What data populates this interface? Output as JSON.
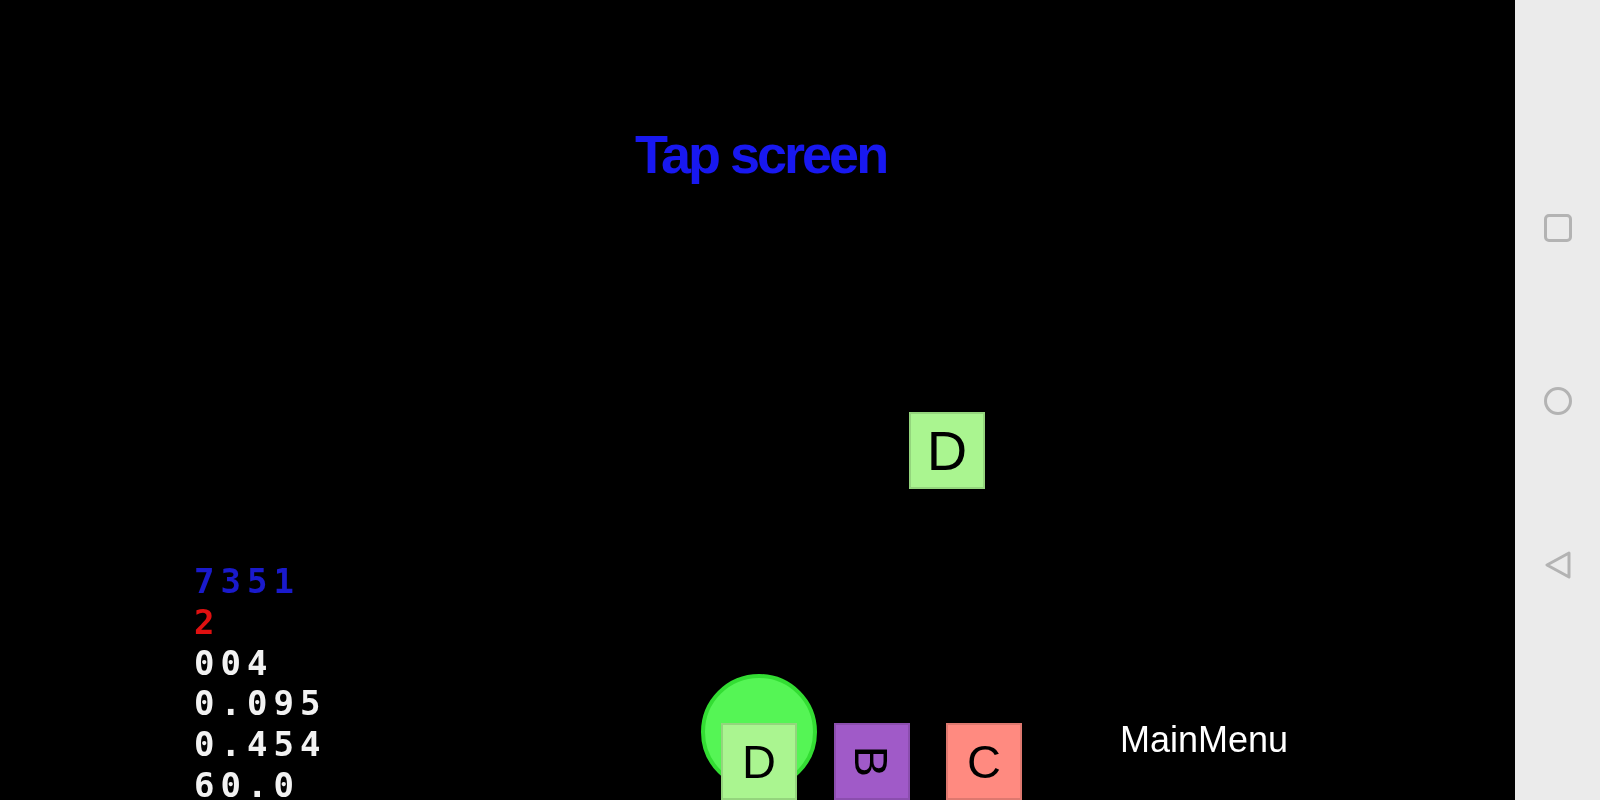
{
  "title": "Tap screen",
  "stats": [
    {
      "text": "7351",
      "color": "#1a1acc"
    },
    {
      "text": "2",
      "color": "#e01010"
    },
    {
      "text": "004",
      "color": "#f2f2f2"
    },
    {
      "text": "0.095",
      "color": "#f2f2f2"
    },
    {
      "text": "0.454",
      "color": "#f2f2f2"
    },
    {
      "text": "60.0",
      "color": "#f2f2f2"
    }
  ],
  "falling_tiles": [
    {
      "letter": "D",
      "color": "#aaf590"
    }
  ],
  "tray_tiles": [
    {
      "letter": "D",
      "color": "#aaf590",
      "selected": true,
      "rotated": false
    },
    {
      "letter": "B",
      "color": "#a05ac8",
      "selected": false,
      "rotated": true
    },
    {
      "letter": "C",
      "color": "#ff8a80",
      "selected": false,
      "rotated": false
    }
  ],
  "main_menu_button": "MainMenu"
}
